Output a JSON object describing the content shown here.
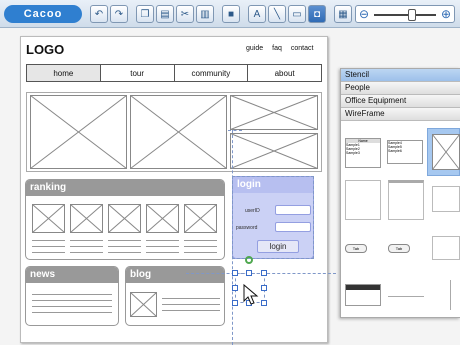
{
  "app": {
    "logo": "Cacoo"
  },
  "toolbar": {
    "icons": [
      "save-icon",
      "redo-icon",
      "copy-icon",
      "paste-icon",
      "cut-icon",
      "clipboard-icon",
      "shape-icon",
      "text-icon",
      "line-icon",
      "image-icon",
      "photo-icon",
      "grid-icon",
      "snap-icon",
      "info-icon"
    ],
    "zoom_out_icon": "zoom-out-icon",
    "zoom_in_icon": "zoom-in-icon",
    "zoom_level": 0.5
  },
  "wireframe": {
    "logo": "LOGO",
    "links": [
      "guide",
      "faq",
      "contact"
    ],
    "nav": [
      "home",
      "tour",
      "community",
      "about"
    ],
    "ranking_title": "ranking",
    "login_title": "login",
    "login_userid": "userID",
    "login_password": "password",
    "login_button": "login",
    "news_title": "news",
    "blog_title": "blog"
  },
  "stencil": {
    "categories": [
      "Stencil",
      "People",
      "Office Equipment",
      "WireFrame"
    ],
    "active": "Stencil",
    "table_header": "Name",
    "table_rows": [
      "Sample1",
      "Sample2",
      "Sample3"
    ],
    "table_rows_b": [
      "Sample4",
      "Sample5",
      "Sample6"
    ],
    "button_labels": [
      "Tab",
      "Tab"
    ]
  },
  "colors": {
    "accent": "#2f7fd0",
    "selection": "#3a6cc8",
    "login_panel": "#c9cff5",
    "panel_header": "#999999"
  }
}
